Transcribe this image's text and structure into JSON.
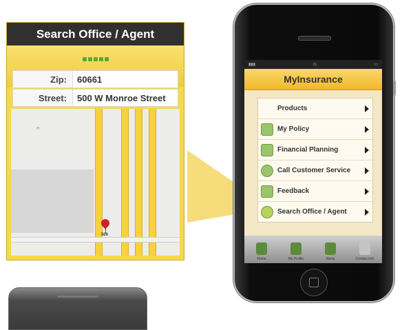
{
  "search_screen": {
    "title": "Search Office / Agent",
    "zip_label": "Zip:",
    "zip_value": "60661",
    "street_label": "Street:",
    "street_value": "500 W Monroe Street",
    "pin_label": "500"
  },
  "phone": {
    "app_title": "MyInsurance",
    "menu_items": [
      {
        "label": "Products"
      },
      {
        "label": "My Policy"
      },
      {
        "label": "Financial Planning"
      },
      {
        "label": "Call Customer Service"
      },
      {
        "label": "Feedback"
      },
      {
        "label": "Search Office / Agent"
      }
    ],
    "tabs": [
      {
        "label": "Home"
      },
      {
        "label": "My Profile"
      },
      {
        "label": "Alerts"
      },
      {
        "label": "Contact Info"
      }
    ]
  },
  "colors": {
    "accent_yellow": "#f2c83a",
    "titlebar_dark": "#303030",
    "progress_green": "#5aa832",
    "pin_red": "#d0202a"
  }
}
